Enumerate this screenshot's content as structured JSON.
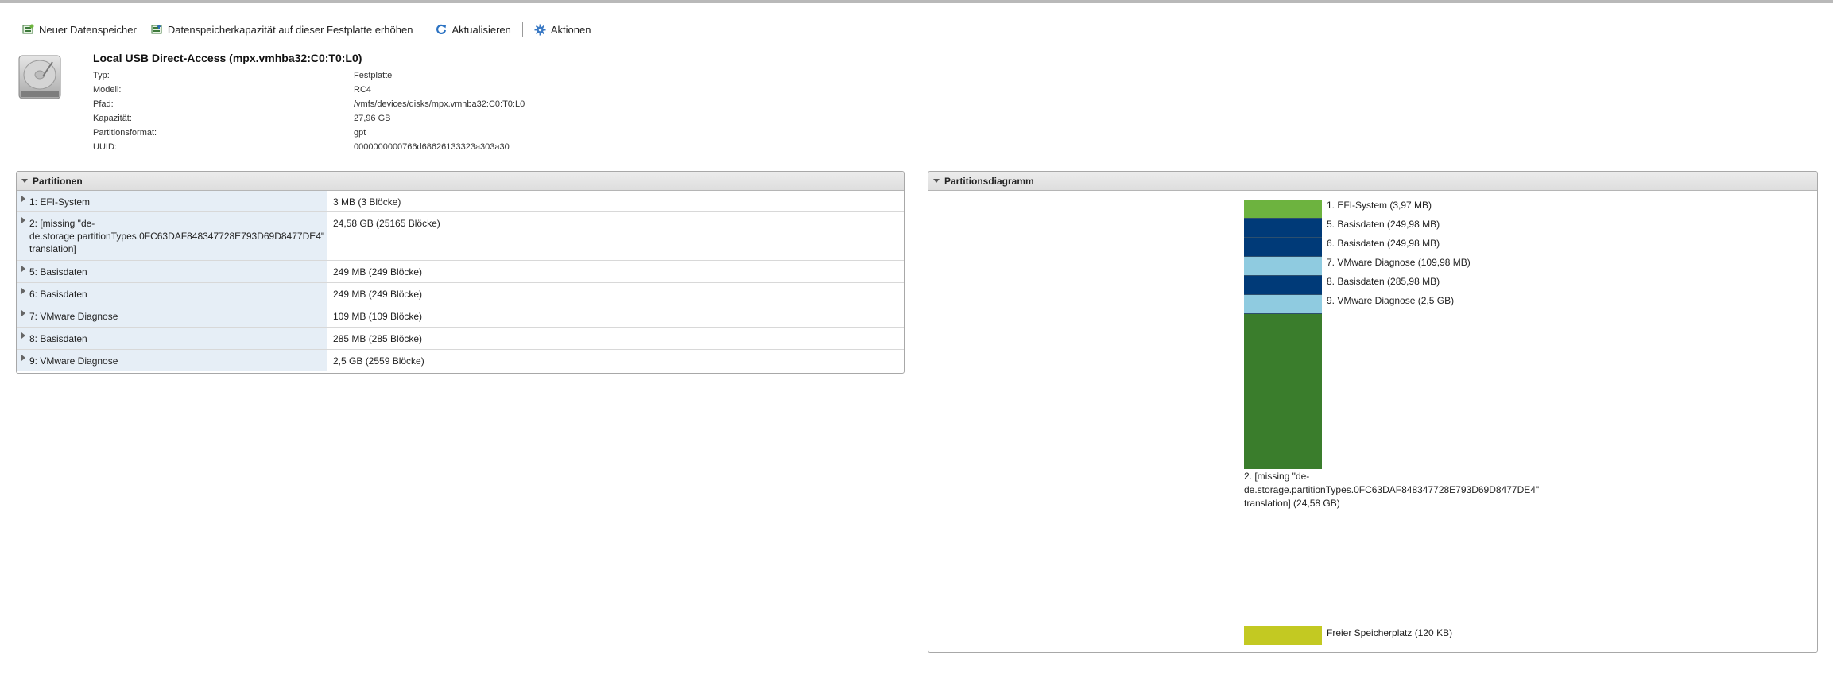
{
  "toolbar": {
    "new_datastore": "Neuer Datenspeicher",
    "increase_capacity": "Datenspeicherkapazität auf dieser Festplatte erhöhen",
    "refresh": "Aktualisieren",
    "actions": "Aktionen"
  },
  "device": {
    "title": "Local USB Direct-Access (mpx.vmhba32:C0:T0:L0)",
    "properties": [
      {
        "label": "Typ:",
        "value": "Festplatte"
      },
      {
        "label": "Modell:",
        "value": "RC4"
      },
      {
        "label": "Pfad:",
        "value": "/vmfs/devices/disks/mpx.vmhba32:C0:T0:L0"
      },
      {
        "label": "Kapazität:",
        "value": "27,96 GB"
      },
      {
        "label": "Partitionsformat:",
        "value": "gpt"
      },
      {
        "label": "UUID:",
        "value": "0000000000766d68626133323a303a30"
      }
    ]
  },
  "partitions_panel": {
    "title": "Partitionen",
    "rows": [
      {
        "name": "1: EFI-System",
        "value": "3 MB (3 Blöcke)"
      },
      {
        "name": "2: [missing \"de-de.storage.partitionTypes.0FC63DAF848347728E793D69D8477DE4\" translation]",
        "value": "24,58 GB (25165 Blöcke)"
      },
      {
        "name": "5: Basisdaten",
        "value": "249 MB (249 Blöcke)"
      },
      {
        "name": "6: Basisdaten",
        "value": "249 MB (249 Blöcke)"
      },
      {
        "name": "7: VMware Diagnose",
        "value": "109 MB (109 Blöcke)"
      },
      {
        "name": "8: Basisdaten",
        "value": "285 MB (285 Blöcke)"
      },
      {
        "name": "9: VMware Diagnose",
        "value": "2,5 GB (2559 Blöcke)"
      }
    ]
  },
  "diagram_panel": {
    "title": "Partitionsdiagramm",
    "segments": [
      {
        "label": "1. EFI-System  (3,97 MB)",
        "color": "#6db33f"
      },
      {
        "label": "5. Basisdaten  (249,98 MB)",
        "color": "#003a78"
      },
      {
        "label": "6. Basisdaten  (249,98 MB)",
        "color": "#003a78"
      },
      {
        "label": "7. VMware Diagnose  (109,98 MB)",
        "color": "#8fcbe0"
      },
      {
        "label": "8. Basisdaten  (285,98 MB)",
        "color": "#003a78"
      },
      {
        "label": "9. VMware Diagnose  (2,5 GB)",
        "color": "#8fcbe0"
      }
    ],
    "large_partition": {
      "label": "2. [missing \"de-de.storage.partitionTypes.0FC63DAF848347728E793D69D8477DE4\" translation]  (24,58 GB)",
      "color": "#3a7d2c"
    },
    "free_space": {
      "label": "Freier Speicherplatz  (120 KB)",
      "color": "#c3c922"
    }
  }
}
